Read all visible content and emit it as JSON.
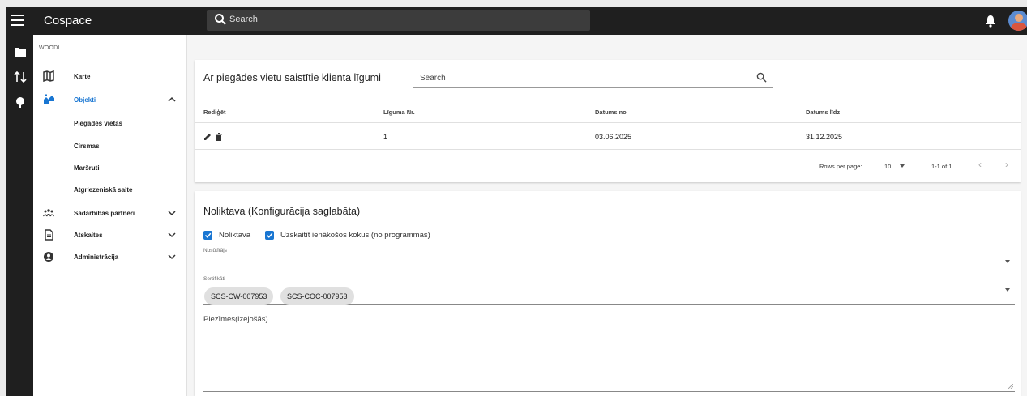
{
  "app": {
    "title": "Cospace"
  },
  "topbar": {
    "search_placeholder": "Search"
  },
  "sidebar": {
    "org": "WOODL",
    "items": [
      {
        "label": "Karte",
        "icon": "map-icon"
      },
      {
        "label": "Objekti",
        "icon": "sites-icon",
        "active": true
      },
      {
        "label": "Sadarbības partneri",
        "icon": "partners-icon"
      },
      {
        "label": "Atskaites",
        "icon": "reports-icon"
      },
      {
        "label": "Administrācija",
        "icon": "admin-icon"
      }
    ],
    "subitems": [
      "Piegādes vietas",
      "Cirsmas",
      "Maršruti",
      "Atgriezeniskā saite"
    ]
  },
  "contracts": {
    "title": "Ar piegādes vietu saistītie klienta līgumi",
    "search_placeholder": "Search",
    "columns": [
      "Rediģēt",
      "Līguma Nr.",
      "Datums no",
      "Datums līdz"
    ],
    "rows": [
      {
        "contract_no": "1",
        "date_from": "03.06.2025",
        "date_to": "31.12.2025"
      }
    ],
    "pagination": {
      "rows_per_page_label": "Rows per page:",
      "rows_per_page": "10",
      "range": "1-1 of 1"
    }
  },
  "config": {
    "title": "Noliktava (Konfigurācija saglabāta)",
    "checkboxes": [
      {
        "label": "Noliktava",
        "checked": true
      },
      {
        "label": "Uzskaitīt ienākošos kokus (no programmas)",
        "checked": true
      }
    ],
    "sender_label": "Nosūtītājs",
    "certificates_label": "Sertifikāti",
    "certificates": [
      "SCS-CW-007953",
      "SCS-COC-007953"
    ],
    "notes_placeholder": "Piezīmes(izejošās)"
  },
  "colors": {
    "accent": "#1976d2",
    "topbar": "#1f1f1f"
  }
}
